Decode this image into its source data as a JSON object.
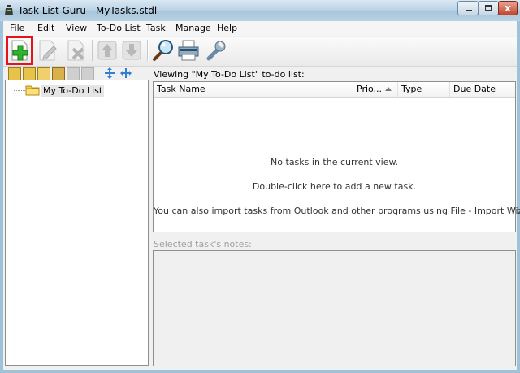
{
  "window": {
    "title": "Task List Guru - MyTasks.stdl",
    "close_glyph": "x",
    "accent_color": "#e3151a"
  },
  "menu": {
    "items": [
      "File",
      "Edit",
      "View",
      "To-Do List",
      "Task",
      "Manage",
      "Help"
    ]
  },
  "toolbar": {
    "buttons": [
      {
        "icon": "add-plus-icon",
        "enabled": true,
        "highlighted": true
      },
      {
        "icon": "edit-pencil-icon",
        "enabled": false
      },
      {
        "icon": "delete-x-icon",
        "enabled": false
      },
      {
        "icon": "move-up-icon",
        "enabled": false
      },
      {
        "icon": "move-down-icon",
        "enabled": false
      },
      {
        "icon": "find-magnifier-icon",
        "enabled": true
      },
      {
        "icon": "print-icon",
        "enabled": true
      },
      {
        "icon": "options-wrench-icon",
        "enabled": true
      }
    ]
  },
  "tree": {
    "items": [
      {
        "label": "My To-Do List",
        "selected": true
      }
    ]
  },
  "tasks": {
    "viewing_label": "Viewing \"My To-Do List\" to-do list:",
    "columns": [
      "Task Name",
      "Prio...",
      "Type",
      "Due Date"
    ],
    "sorted_column": "Prio...",
    "empty_lines": [
      "No tasks in the current view.",
      "Double-click here to add a new task.",
      "You can also import tasks from Outlook and other programs using File - Import Wizard."
    ]
  },
  "notes": {
    "label": "Selected task's notes:"
  }
}
